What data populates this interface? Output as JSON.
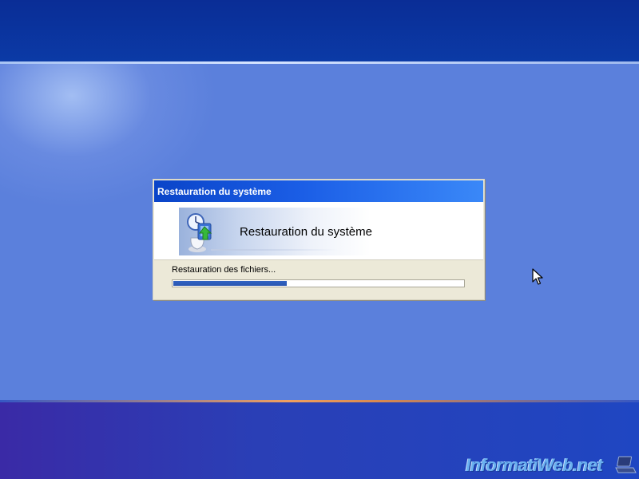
{
  "dialog": {
    "title": "Restauration du système",
    "header_title": "Restauration du système",
    "status": "Restauration des fichiers...",
    "progress_percent": 39
  },
  "watermark": {
    "text": "InformatiWeb.net"
  },
  "icons": {
    "app": "system-restore-icon",
    "cursor": "mouse-pointer-icon",
    "watermark": "laptop-icon"
  },
  "colors": {
    "desktop_blue": "#5a7edc",
    "titlebar_blue": "#0a44c8",
    "progress_blue": "#2f62c2",
    "dialog_face": "#ece9d8"
  }
}
